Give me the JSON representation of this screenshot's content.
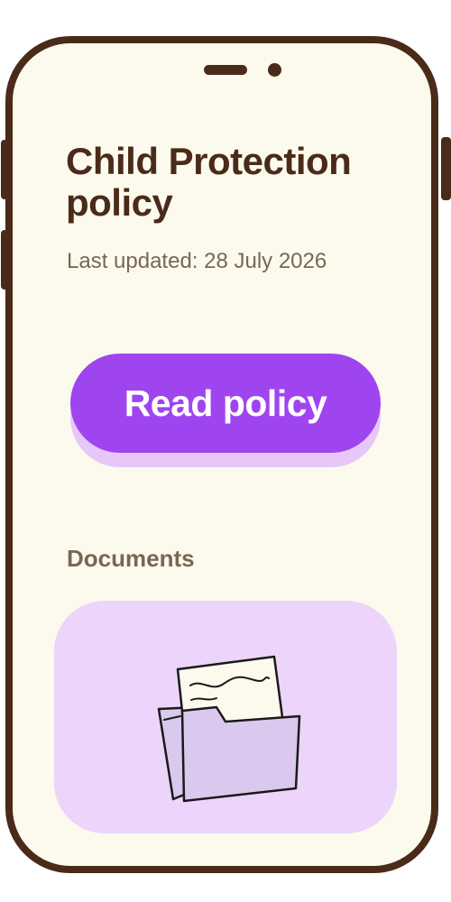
{
  "screen": {
    "title": "Child Protection policy",
    "last_updated": "Last updated: 28 July 2026",
    "read_button_label": "Read policy",
    "documents_section_label": "Documents"
  },
  "colors": {
    "frame": "#4a2a19",
    "screen_background": "#fbfaed",
    "title_text": "#4a2a19",
    "secondary_text": "#7a6655",
    "primary_button": "#9f45f0",
    "primary_button_shadow": "#e7c7f8",
    "document_card": "#ecd4fa",
    "folder_fill": "#dac8ee"
  },
  "icons": {
    "document_card_icon": "folder-with-document-icon"
  }
}
